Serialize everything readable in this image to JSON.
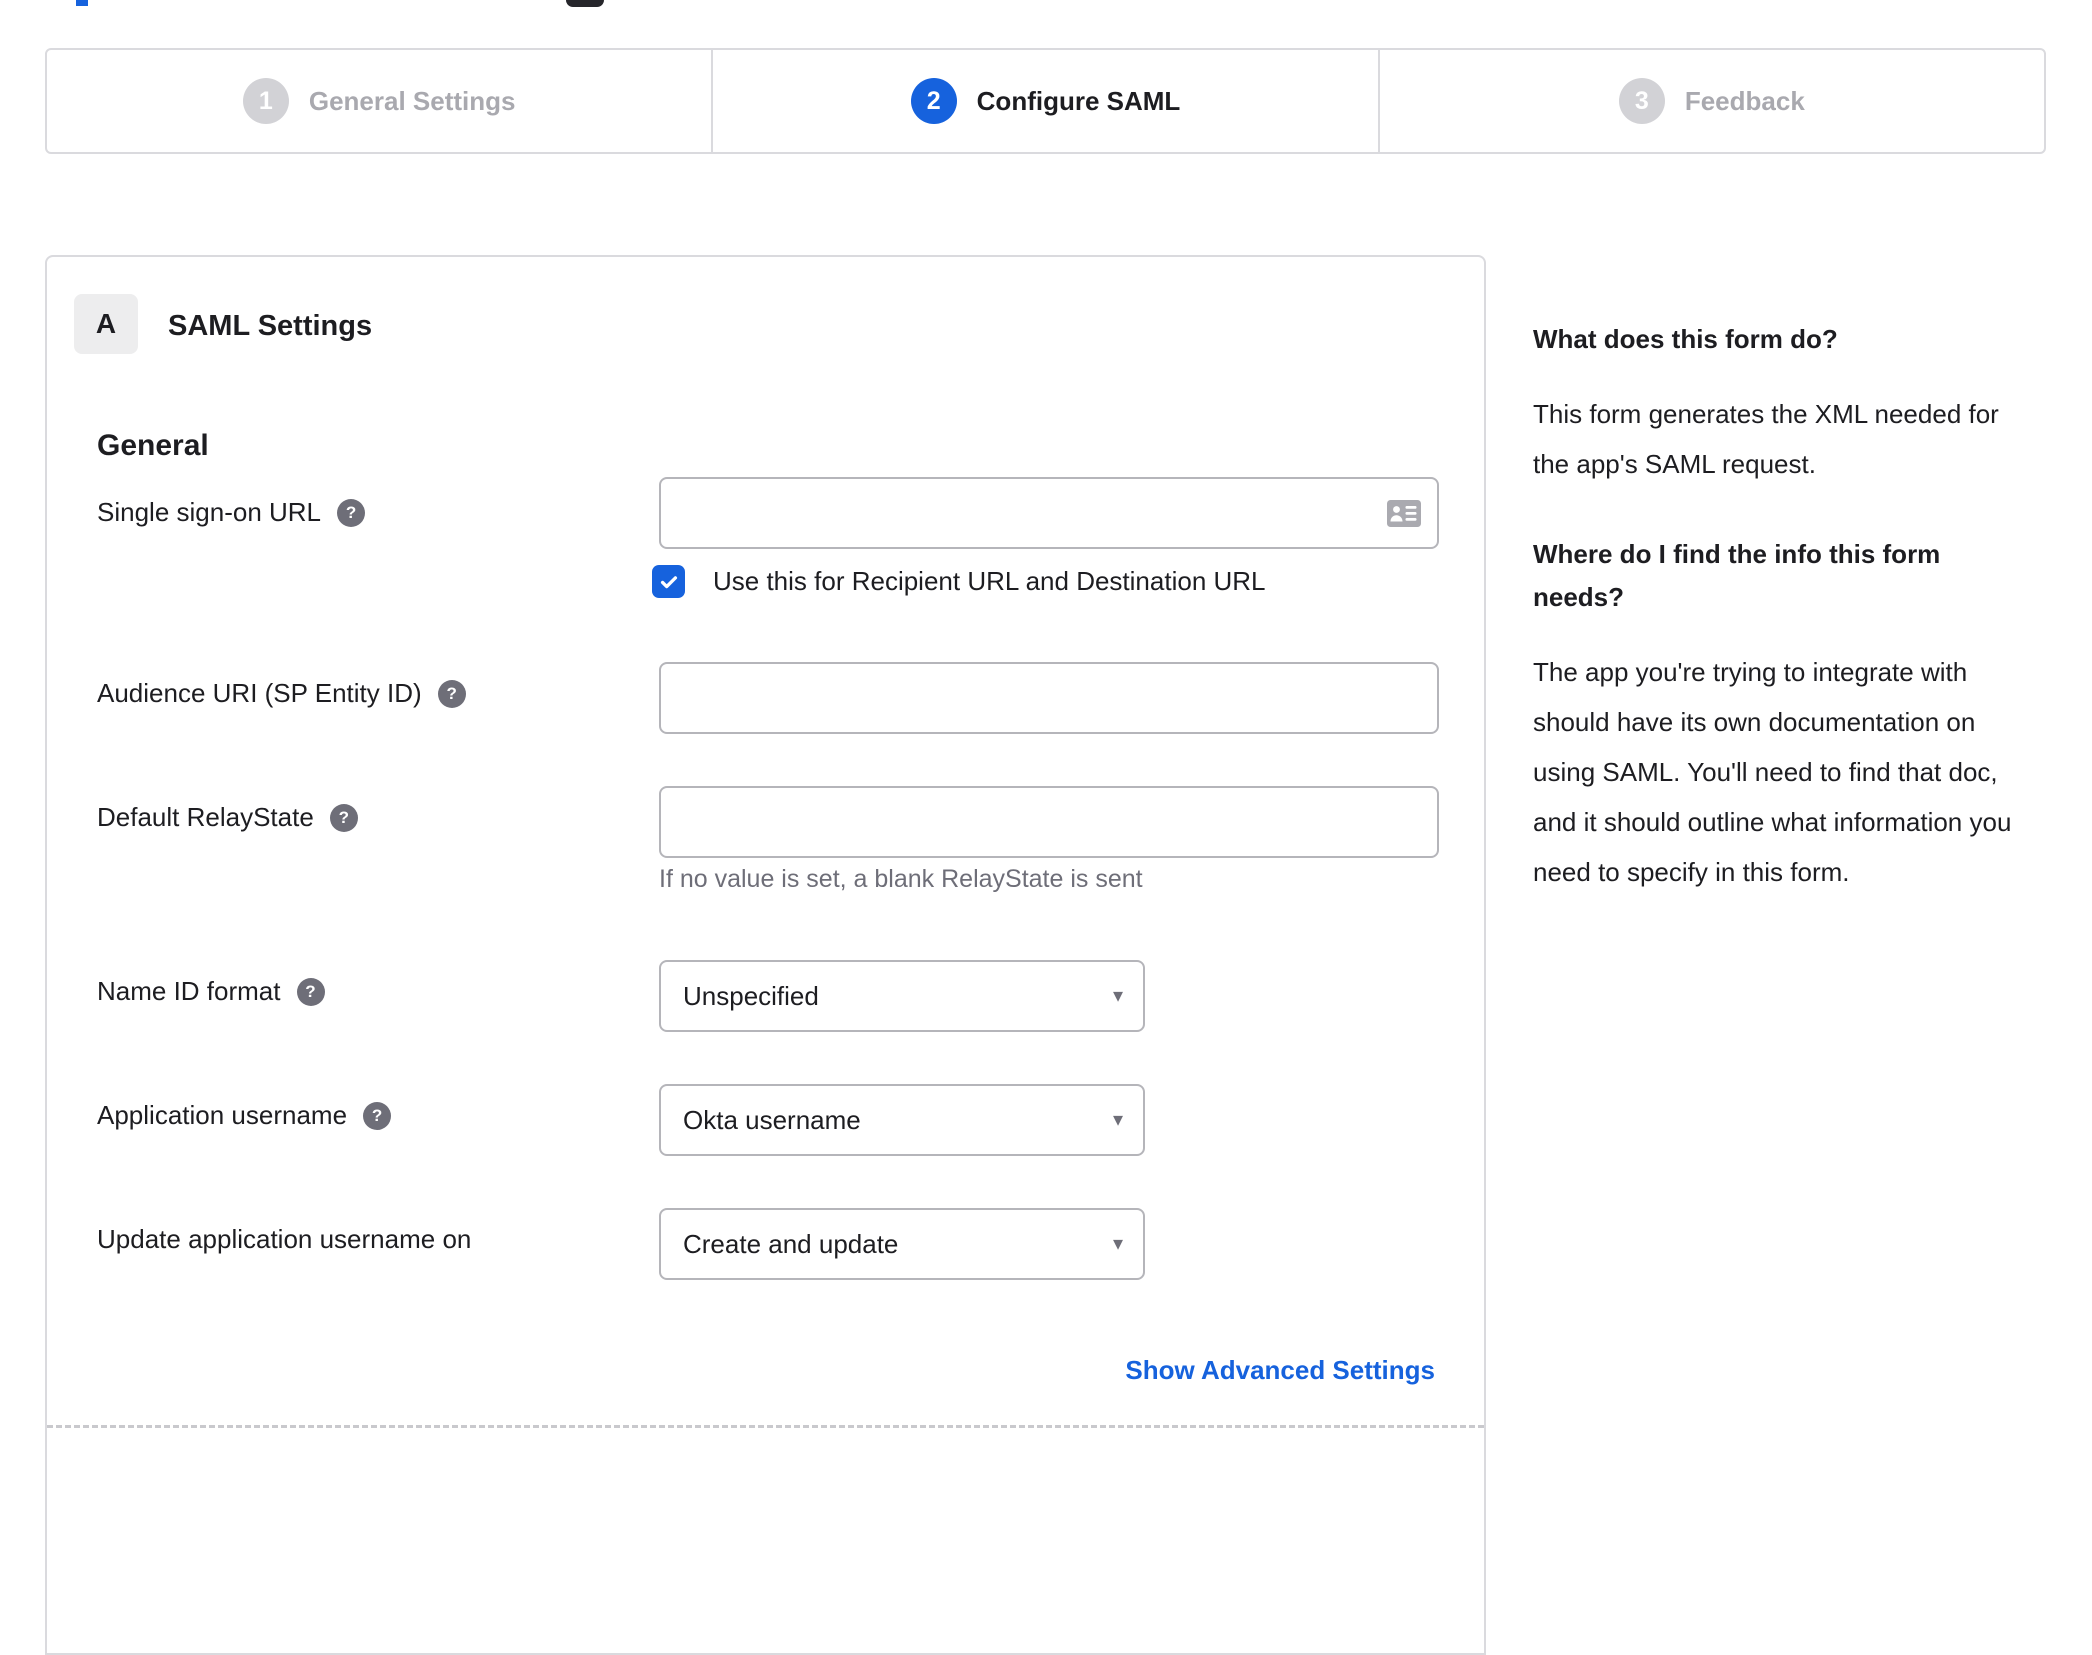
{
  "colors": {
    "accent_blue": "#1662dd",
    "text_dark": "#1d1d21",
    "muted_gray": "#6e6e78",
    "inactive_step_gray": "#a9a9af"
  },
  "icons": {
    "help_glyph": "?",
    "caret_glyph": "▾"
  },
  "stepper": {
    "steps": [
      {
        "number": "1",
        "label": "General Settings",
        "state": "inactive"
      },
      {
        "number": "2",
        "label": "Configure SAML",
        "state": "active"
      },
      {
        "number": "3",
        "label": "Feedback",
        "state": "inactive"
      }
    ]
  },
  "saml_panel": {
    "section_badge": "A",
    "section_title": "SAML Settings",
    "group_heading": "General",
    "fields": {
      "sso_url": {
        "label": "Single sign-on URL",
        "value": "",
        "checkbox_label": "Use this for Recipient URL and Destination URL",
        "checkbox_checked": true
      },
      "audience_uri": {
        "label": "Audience URI (SP Entity ID)",
        "value": ""
      },
      "default_relay_state": {
        "label": "Default RelayState",
        "value": "",
        "helper": "If no value is set, a blank RelayState is sent"
      },
      "name_id_format": {
        "label": "Name ID format",
        "value": "Unspecified"
      },
      "application_username": {
        "label": "Application username",
        "value": "Okta username"
      },
      "update_app_username": {
        "label": "Update application username on",
        "value": "Create and update"
      }
    },
    "advanced_link": "Show Advanced Settings"
  },
  "help_panel": {
    "sections": [
      {
        "heading": "What does this form do?",
        "body": "This form generates the XML needed for the app's SAML request."
      },
      {
        "heading": "Where do I find the info this form needs?",
        "body": "The app you're trying to integrate with should have its own documentation on using SAML. You'll need to find that doc, and it should outline what information you need to specify in this form."
      }
    ]
  }
}
